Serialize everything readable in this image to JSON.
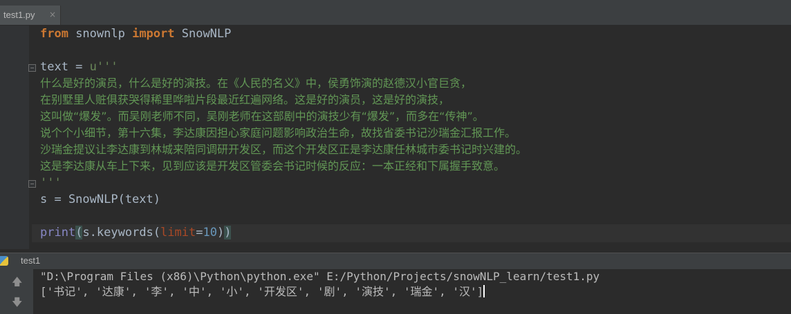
{
  "tab": {
    "label": "test1.py",
    "close_glyph": "×"
  },
  "code": {
    "line1": {
      "kw_from": "from",
      "module": " snownlp ",
      "kw_import": "import",
      "cls": " SnowNLP"
    },
    "line3": {
      "lhs": "text = ",
      "str": "u'''"
    },
    "comment_lines": [
      "什么是好的演员，什么是好的演技。在《人民的名义》中，侯勇饰演的赵德汉小官巨贪，",
      "在别墅里人赃俱获哭得稀里哗啦片段最近红遍网络。这是好的演员，这是好的演技，",
      "这叫做“爆发”。而吴刚老师不同，吴刚老师在这部剧中的演技少有“爆发”，而多在“传神”。",
      "说个个小细节，第十六集，李达康因担心家庭问题影响政治生命，故找省委书记沙瑞金汇报工作。",
      "沙瑞金提议让李达康到林城来陪同调研开发区，而这个开发区正是李达康任林城市委书记时兴建的。",
      "这是李达康从车上下来，见到应该是开发区管委会书记时候的反应：一本正经和下属握手致意。"
    ],
    "string_end": "'''",
    "line_s": "s = SnowNLP(text)",
    "print_line": {
      "fn": "print",
      "open": "(",
      "obj": "s.keywords(",
      "param": "limit",
      "eq": "=",
      "num": "10",
      "close_inner": ")",
      "close_outer": ")"
    }
  },
  "run": {
    "title": "test1"
  },
  "console": {
    "line1": "\"D:\\Program Files (x86)\\Python\\python.exe\" E:/Python/Projects/snowNLP_learn/test1.py",
    "line2": "['书记', '达康', '李', '中', '小', '开发区', '剧', '演技', '瑞金', '汉']"
  },
  "icons": {
    "up": "up-arrow-icon",
    "down": "down-arrow-icon",
    "python": "python-icon"
  },
  "colors": {
    "keyword": "#cc7832",
    "string": "#6a8759",
    "comment": "#629755",
    "number": "#6897bb",
    "param": "#aa4926",
    "builtin": "#8888c6",
    "background": "#2b2b2b"
  }
}
